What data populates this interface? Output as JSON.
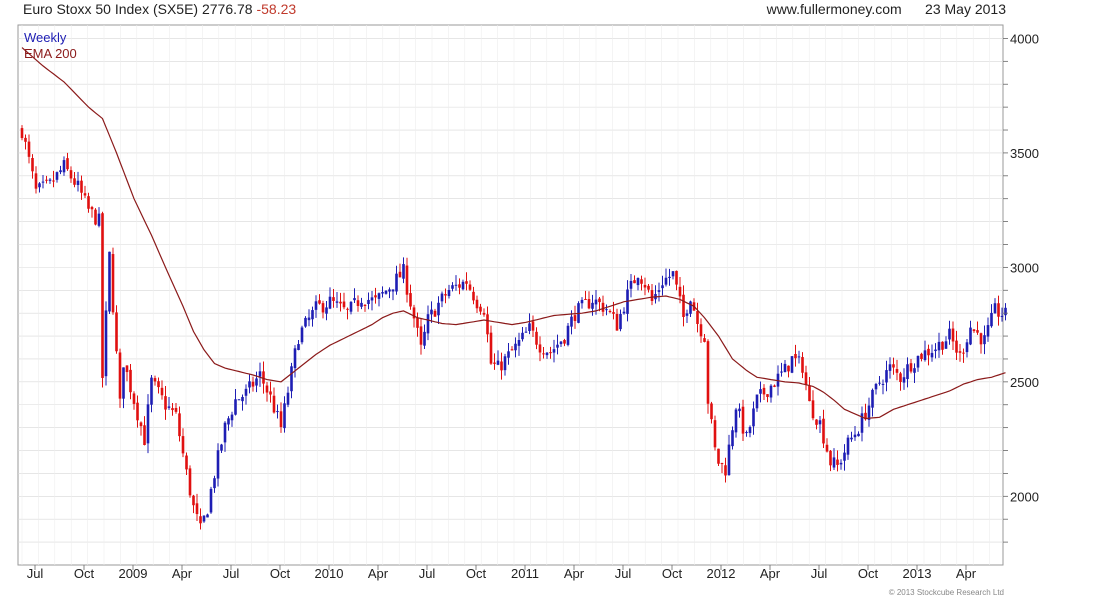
{
  "header": {
    "title": "Euro Stoxx 50 Index (SX5E)",
    "last": "2776.78",
    "change": "-58.23",
    "site": "www.fullermoney.com",
    "date": "23 May 2013"
  },
  "legend": {
    "frequency": "Weekly",
    "ema": "EMA 200"
  },
  "copyright": "© 2013 Stockcube Research Ltd",
  "colors": {
    "up": "#1e1eb4",
    "down": "#e01010",
    "ema": "#8b1a1a",
    "grid": "#d8d8d8"
  },
  "chart_data": {
    "type": "candlestick",
    "title": "Euro Stoxx 50 Index (SX5E)",
    "xlabels": [
      "Jul",
      "Oct",
      "2009",
      "Apr",
      "Jul",
      "Oct",
      "2010",
      "Apr",
      "Jul",
      "Oct",
      "2011",
      "Apr",
      "Jul",
      "Oct",
      "2012",
      "Apr",
      "Jul",
      "Oct",
      "2013",
      "Apr"
    ],
    "ylim": [
      1700,
      4050
    ],
    "yticks": [
      2000,
      2500,
      3000,
      3500,
      4000
    ],
    "grid": true,
    "axis": "right",
    "week_count": 253,
    "close_points": [
      [
        0,
        3600
      ],
      [
        4,
        3330
      ],
      [
        8,
        3360
      ],
      [
        12,
        3440
      ],
      [
        16,
        3350
      ],
      [
        19,
        3250
      ],
      [
        22,
        3200
      ],
      [
        23,
        2520
      ],
      [
        25,
        3050
      ],
      [
        28,
        2400
      ],
      [
        29,
        2590
      ],
      [
        32,
        2420
      ],
      [
        35,
        2250
      ],
      [
        37,
        2500
      ],
      [
        39,
        2450
      ],
      [
        41,
        2400
      ],
      [
        44,
        2350
      ],
      [
        47,
        2100
      ],
      [
        49,
        1950
      ],
      [
        51,
        1850
      ],
      [
        53,
        1950
      ],
      [
        55,
        2100
      ],
      [
        58,
        2300
      ],
      [
        61,
        2420
      ],
      [
        64,
        2450
      ],
      [
        68,
        2530
      ],
      [
        71,
        2430
      ],
      [
        74,
        2300
      ],
      [
        76,
        2460
      ],
      [
        79,
        2700
      ],
      [
        84,
        2820
      ],
      [
        88,
        2850
      ],
      [
        93,
        2800
      ],
      [
        97,
        2870
      ],
      [
        101,
        2850
      ],
      [
        106,
        2930
      ],
      [
        109,
        2980
      ],
      [
        112,
        2780
      ],
      [
        114,
        2640
      ],
      [
        116,
        2770
      ],
      [
        119,
        2840
      ],
      [
        122,
        2900
      ],
      [
        127,
        2940
      ],
      [
        130,
        2850
      ],
      [
        132,
        2820
      ],
      [
        134,
        2580
      ],
      [
        136,
        2560
      ],
      [
        141,
        2650
      ],
      [
        145,
        2730
      ],
      [
        148,
        2660
      ],
      [
        151,
        2630
      ],
      [
        155,
        2700
      ],
      [
        158,
        2800
      ],
      [
        163,
        2860
      ],
      [
        167,
        2820
      ],
      [
        170,
        2750
      ],
      [
        173,
        2880
      ],
      [
        176,
        2980
      ],
      [
        178,
        2930
      ],
      [
        180,
        2850
      ],
      [
        183,
        2940
      ],
      [
        186,
        2970
      ],
      [
        189,
        2780
      ],
      [
        191,
        2880
      ],
      [
        193,
        2760
      ],
      [
        195,
        2700
      ],
      [
        196,
        2420
      ],
      [
        198,
        2200
      ],
      [
        199,
        2150
      ],
      [
        201,
        2120
      ],
      [
        204,
        2400
      ],
      [
        207,
        2250
      ],
      [
        210,
        2420
      ],
      [
        215,
        2500
      ],
      [
        218,
        2550
      ],
      [
        220,
        2600
      ],
      [
        223,
        2570
      ],
      [
        225,
        2400
      ],
      [
        228,
        2320
      ],
      [
        231,
        2150
      ],
      [
        233,
        2130
      ],
      [
        236,
        2230
      ],
      [
        239,
        2300
      ],
      [
        242,
        2400
      ],
      [
        245,
        2500
      ],
      [
        248,
        2560
      ],
      [
        251,
        2520
      ],
      [
        254,
        2580
      ],
      [
        257,
        2620
      ],
      [
        261,
        2650
      ],
      [
        265,
        2700
      ],
      [
        268,
        2610
      ],
      [
        271,
        2740
      ],
      [
        275,
        2680
      ],
      [
        278,
        2810
      ],
      [
        281,
        2790
      ]
    ],
    "ema_points": [
      [
        0,
        3960
      ],
      [
        6,
        3880
      ],
      [
        12,
        3810
      ],
      [
        19,
        3700
      ],
      [
        23,
        3650
      ],
      [
        27,
        3500
      ],
      [
        32,
        3300
      ],
      [
        37,
        3140
      ],
      [
        41,
        3000
      ],
      [
        46,
        2830
      ],
      [
        49,
        2720
      ],
      [
        52,
        2640
      ],
      [
        55,
        2580
      ],
      [
        58,
        2560
      ],
      [
        62,
        2545
      ],
      [
        66,
        2530
      ],
      [
        70,
        2510
      ],
      [
        74,
        2500
      ],
      [
        79,
        2560
      ],
      [
        84,
        2620
      ],
      [
        88,
        2660
      ],
      [
        92,
        2690
      ],
      [
        96,
        2720
      ],
      [
        100,
        2750
      ],
      [
        103,
        2780
      ],
      [
        106,
        2800
      ],
      [
        109,
        2810
      ],
      [
        113,
        2780
      ],
      [
        116,
        2770
      ],
      [
        120,
        2755
      ],
      [
        124,
        2750
      ],
      [
        128,
        2760
      ],
      [
        132,
        2770
      ],
      [
        136,
        2760
      ],
      [
        140,
        2750
      ],
      [
        144,
        2760
      ],
      [
        148,
        2775
      ],
      [
        152,
        2790
      ],
      [
        156,
        2795
      ],
      [
        160,
        2800
      ],
      [
        164,
        2810
      ],
      [
        168,
        2830
      ],
      [
        172,
        2850
      ],
      [
        176,
        2860
      ],
      [
        180,
        2870
      ],
      [
        184,
        2875
      ],
      [
        188,
        2860
      ],
      [
        192,
        2830
      ],
      [
        195,
        2780
      ],
      [
        199,
        2700
      ],
      [
        203,
        2600
      ],
      [
        207,
        2550
      ],
      [
        210,
        2520
      ],
      [
        214,
        2510
      ],
      [
        218,
        2500
      ],
      [
        222,
        2495
      ],
      [
        226,
        2480
      ],
      [
        229,
        2455
      ],
      [
        232,
        2420
      ],
      [
        235,
        2380
      ],
      [
        238,
        2360
      ],
      [
        241,
        2340
      ],
      [
        245,
        2345
      ],
      [
        249,
        2380
      ],
      [
        253,
        2400
      ],
      [
        257,
        2420
      ],
      [
        261,
        2440
      ],
      [
        265,
        2460
      ],
      [
        269,
        2490
      ],
      [
        273,
        2510
      ],
      [
        277,
        2520
      ],
      [
        281,
        2540
      ]
    ]
  }
}
